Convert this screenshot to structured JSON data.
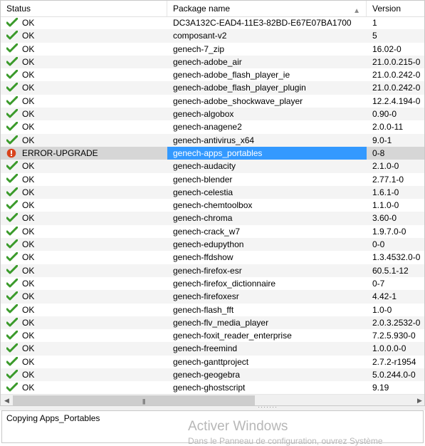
{
  "columns": {
    "status": "Status",
    "package": "Package name",
    "version": "Version"
  },
  "rows": [
    {
      "status": "OK",
      "package": "DC3A132C-EAD4-11E3-82BD-E67E07BA1700",
      "version": "1"
    },
    {
      "status": "OK",
      "package": "composant-v2",
      "version": "5"
    },
    {
      "status": "OK",
      "package": "genech-7_zip",
      "version": "16.02-0"
    },
    {
      "status": "OK",
      "package": "genech-adobe_air",
      "version": "21.0.0.215-0"
    },
    {
      "status": "OK",
      "package": "genech-adobe_flash_player_ie",
      "version": "21.0.0.242-0"
    },
    {
      "status": "OK",
      "package": "genech-adobe_flash_player_plugin",
      "version": "21.0.0.242-0"
    },
    {
      "status": "OK",
      "package": "genech-adobe_shockwave_player",
      "version": "12.2.4.194-0"
    },
    {
      "status": "OK",
      "package": "genech-algobox",
      "version": "0.90-0"
    },
    {
      "status": "OK",
      "package": "genech-anagene2",
      "version": "2.0.0-11"
    },
    {
      "status": "OK",
      "package": "genech-antivirus_x64",
      "version": "9.0-1"
    },
    {
      "status": "ERROR-UPGRADE",
      "package": "genech-apps_portables",
      "version": "0-8",
      "error": true
    },
    {
      "status": "OK",
      "package": "genech-audacity",
      "version": "2.1.0-0"
    },
    {
      "status": "OK",
      "package": "genech-blender",
      "version": "2.77.1-0"
    },
    {
      "status": "OK",
      "package": "genech-celestia",
      "version": "1.6.1-0"
    },
    {
      "status": "OK",
      "package": "genech-chemtoolbox",
      "version": "1.1.0-0"
    },
    {
      "status": "OK",
      "package": "genech-chroma",
      "version": "3.60-0"
    },
    {
      "status": "OK",
      "package": "genech-crack_w7",
      "version": "1.9.7.0-0"
    },
    {
      "status": "OK",
      "package": "genech-edupython",
      "version": "0-0"
    },
    {
      "status": "OK",
      "package": "genech-ffdshow",
      "version": "1.3.4532.0-0"
    },
    {
      "status": "OK",
      "package": "genech-firefox-esr",
      "version": "60.5.1-12"
    },
    {
      "status": "OK",
      "package": "genech-firefox_dictionnaire",
      "version": "0-7"
    },
    {
      "status": "OK",
      "package": "genech-firefoxesr",
      "version": "4.42-1"
    },
    {
      "status": "OK",
      "package": "genech-flash_fft",
      "version": "1.0-0"
    },
    {
      "status": "OK",
      "package": "genech-flv_media_player",
      "version": "2.0.3.2532-0"
    },
    {
      "status": "OK",
      "package": "genech-foxit_reader_enterprise",
      "version": "7.2.5.930-0"
    },
    {
      "status": "OK",
      "package": "genech-freemind",
      "version": "1.0.0.0-0"
    },
    {
      "status": "OK",
      "package": "genech-ganttproject",
      "version": "2.7.2-r1954"
    },
    {
      "status": "OK",
      "package": "genech-geogebra",
      "version": "5.0.244.0-0"
    },
    {
      "status": "OK",
      "package": "genech-ghostscript",
      "version": "9.19"
    }
  ],
  "log": {
    "text": "Copying Apps_Portables"
  },
  "watermark": {
    "title": "Activer Windows",
    "subtitle": "Dans le Panneau de configuration, ouvrez Système"
  },
  "colors": {
    "selected_bg": "#3399ff",
    "ok_icon": "#3a9a2a",
    "error_icon": "#d9431c"
  },
  "icons": {
    "ok": "check-icon",
    "error": "error-icon",
    "sort": "sort-ascending-icon"
  }
}
